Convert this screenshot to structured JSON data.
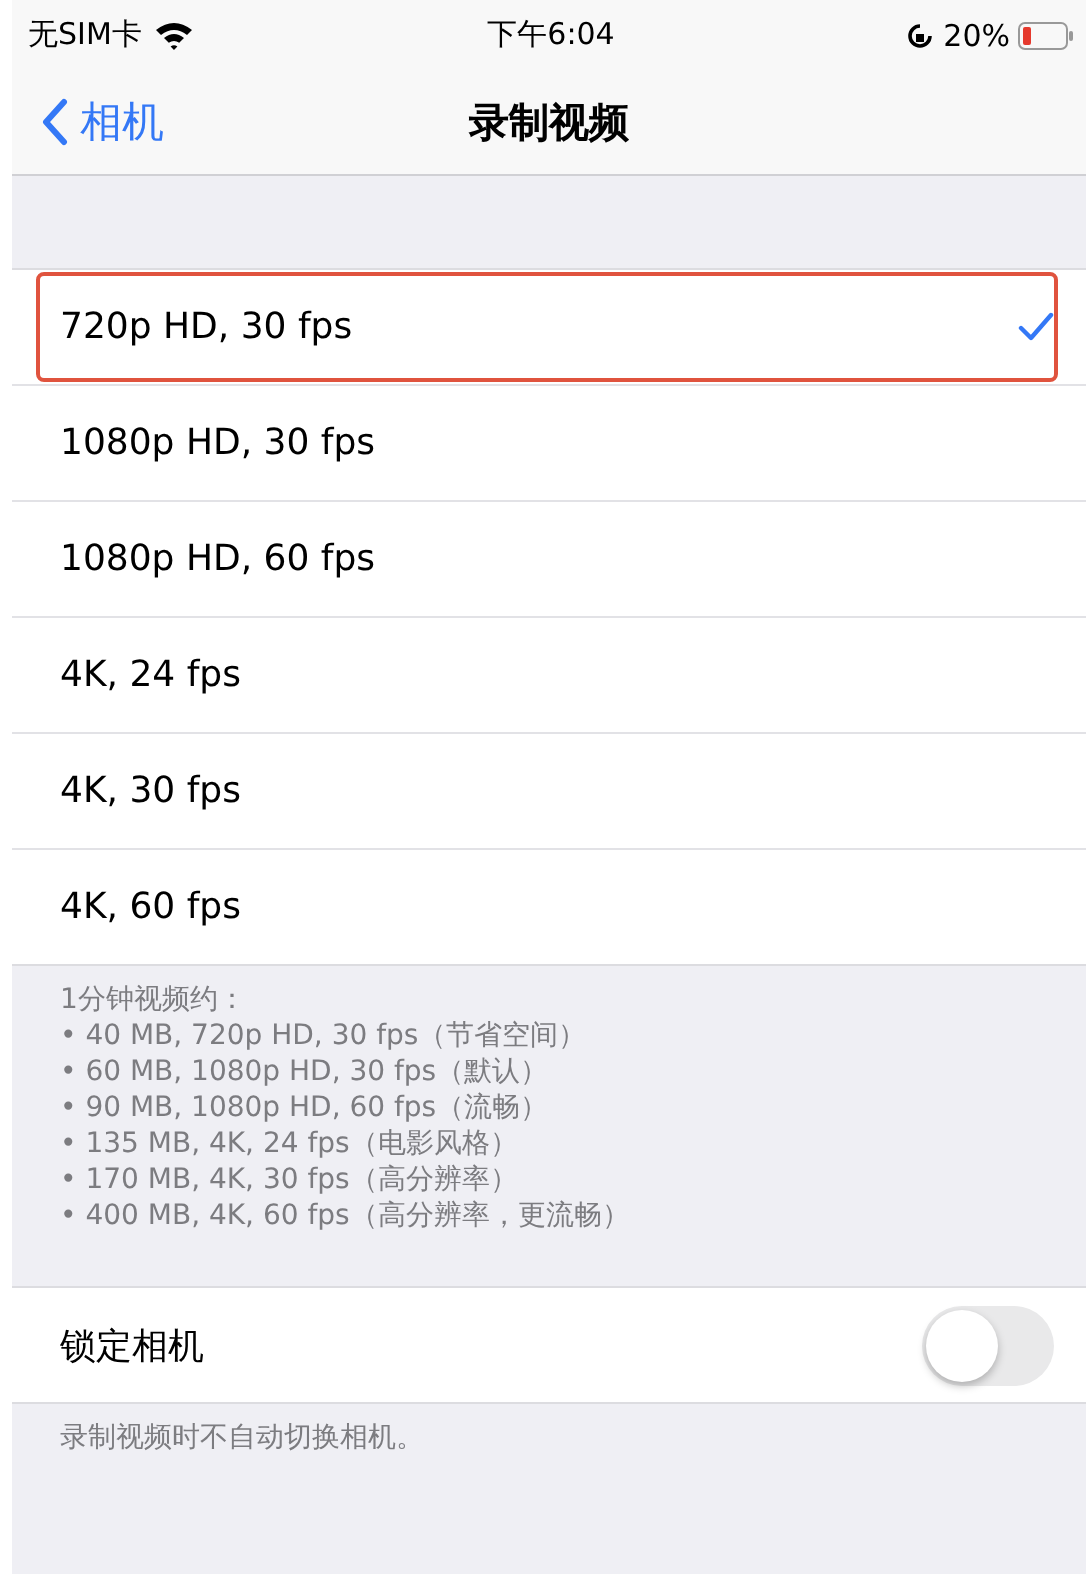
{
  "status_bar": {
    "carrier": "无SIM卡",
    "time": "下午6:04",
    "battery": "20%"
  },
  "nav": {
    "back": "相机",
    "title": "录制视频"
  },
  "options": [
    {
      "label": "720p HD, 30 fps",
      "selected": true,
      "highlighted": true
    },
    {
      "label": "1080p HD, 30 fps",
      "selected": false,
      "highlighted": false
    },
    {
      "label": "1080p HD, 60 fps",
      "selected": false,
      "highlighted": false
    },
    {
      "label": "4K, 24 fps",
      "selected": false,
      "highlighted": false
    },
    {
      "label": "4K, 30 fps",
      "selected": false,
      "highlighted": false
    },
    {
      "label": "4K, 60 fps",
      "selected": false,
      "highlighted": false
    }
  ],
  "size_note": {
    "title": "1分钟视频约：",
    "lines": [
      "• 40 MB, 720p HD, 30 fps（节省空间）",
      "• 60 MB, 1080p HD, 30 fps（默认）",
      "• 90 MB, 1080p HD, 60 fps（流畅）",
      "• 135 MB, 4K, 24 fps（电影风格）",
      "• 170 MB, 4K, 30 fps（高分辨率）",
      "• 400 MB, 4K, 60 fps（高分辨率，更流畅）"
    ]
  },
  "lock_camera": {
    "label": "锁定相机",
    "on": false
  },
  "lock_note": "录制视频时不自动切换相机。"
}
